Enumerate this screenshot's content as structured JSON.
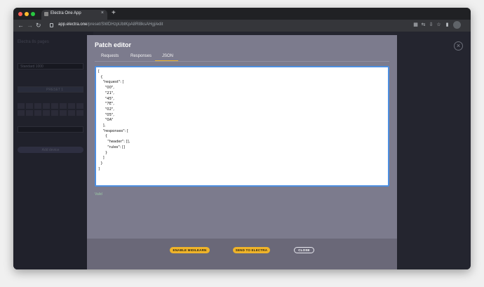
{
  "browser": {
    "tab_title": "Electra One App",
    "tab_close": "×",
    "new_tab": "+",
    "url_domain": "app.electra.one",
    "url_path": "/preset/SWDHzpUbtKpA8Rl8ksAHgj/edit",
    "nav": {
      "back": "←",
      "forward": "→",
      "reload": "↻"
    },
    "controls_colors": {
      "close": "#ff5f57",
      "minimize": "#febc2e",
      "maximize": "#28c840"
    },
    "toolbar_icons": [
      "qr-code-icon",
      "share-icon",
      "download-icon",
      "star-icon",
      "sidebar-icon",
      "profile-icon"
    ]
  },
  "sidebar": {
    "title": "Electra 8s pages",
    "field_top": "Standard 1000",
    "field_mid": "PRESET 1",
    "field_bottom": "",
    "button": "Add device"
  },
  "overlay": {
    "close_glyph": "×"
  },
  "modal": {
    "title": "Patch editor",
    "tabs": [
      {
        "label": "Requests",
        "active": false
      },
      {
        "label": "Responses",
        "active": false
      },
      {
        "label": "JSON",
        "active": true
      }
    ],
    "json_text": "[\n  {\n    \"request\": [\n      \"00\",\n      \"21\",\n      \"45\",\n      \"7E\",\n      \"02\",\n      \"05\",\n      \"0A\"\n    ],\n    \"responses\": [\n      {\n        \"header\": [],\n        \"rules\": []\n      }\n    ]\n  }\n]",
    "validation": "Valid",
    "accent_color": "#f0b429",
    "buttons": {
      "midilearn": "ENABLE MIDILEARN",
      "send": "SEND TO ELECTRA",
      "close": "CLOSE"
    }
  }
}
